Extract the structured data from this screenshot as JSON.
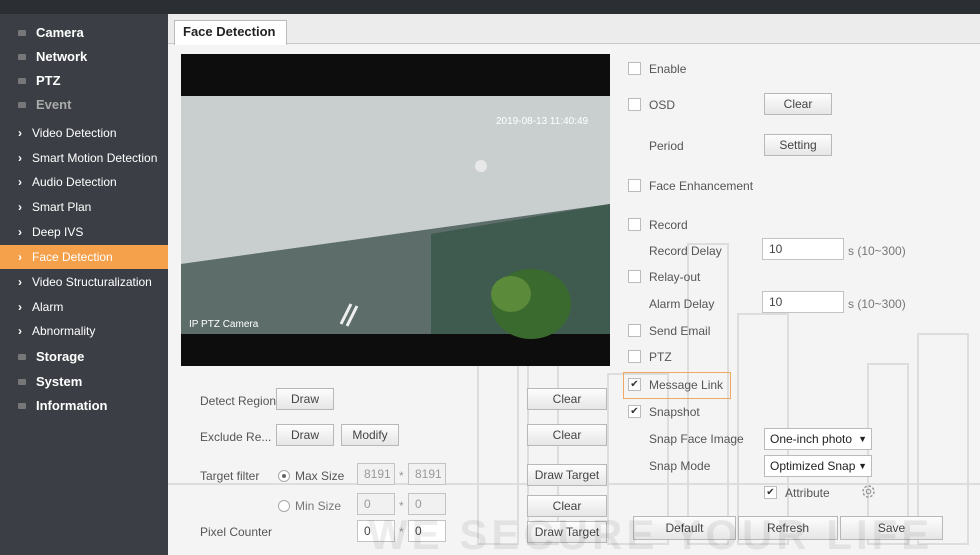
{
  "sidebar": {
    "items": [
      {
        "label": "Camera"
      },
      {
        "label": "Network"
      },
      {
        "label": "PTZ"
      },
      {
        "label": "Event"
      },
      {
        "label": "Storage"
      },
      {
        "label": "System"
      },
      {
        "label": "Information"
      }
    ],
    "sub_items": [
      {
        "label": "Video Detection"
      },
      {
        "label": "Smart Motion Detection"
      },
      {
        "label": "Audio Detection"
      },
      {
        "label": "Smart Plan"
      },
      {
        "label": "Deep IVS"
      },
      {
        "label": "Face Detection"
      },
      {
        "label": "Video Structuralization"
      },
      {
        "label": "Alarm"
      },
      {
        "label": "Abnormality"
      }
    ],
    "active": "Face Detection"
  },
  "tab": {
    "label": "Face Detection"
  },
  "video": {
    "timestamp": "2019-08-13 11:40:49",
    "channel_name": "IP PTZ Camera"
  },
  "left": {
    "detect_region_label": "Detect Region",
    "exclude_label": "Exclude Re...",
    "target_filter_label": "Target filter",
    "max_size_label": "Max Size",
    "min_size_label": "Min Size",
    "pixel_counter_label": "Pixel Counter",
    "draw": "Draw",
    "modify": "Modify",
    "clear": "Clear",
    "draw_target": "Draw Target",
    "max_w": "8191",
    "max_h": "8191",
    "min_w": "0",
    "min_h": "0",
    "pix_w": "0",
    "pix_h": "0",
    "sep": "*"
  },
  "right": {
    "enable": "Enable",
    "osd": "OSD",
    "clear": "Clear",
    "period": "Period",
    "setting": "Setting",
    "face_enhancement": "Face Enhancement",
    "record": "Record",
    "record_delay": "Record Delay",
    "record_delay_value": "10",
    "range": "s (10~300)",
    "relay_out": "Relay-out",
    "alarm_delay": "Alarm Delay",
    "alarm_delay_value": "10",
    "send_email": "Send Email",
    "ptz": "PTZ",
    "message_link": "Message Link",
    "snapshot": "Snapshot",
    "snap_face_image": "Snap Face Image",
    "snap_face_image_value": "One-inch photo",
    "snap_mode": "Snap Mode",
    "snap_mode_value": "Optimized Snap",
    "attribute": "Attribute",
    "check": "✔"
  },
  "footer": {
    "default": "Default",
    "refresh": "Refresh",
    "save": "Save"
  },
  "watermark": "WE SECURE YOUR LIFE",
  "colors": {
    "sidebar": "#3b3f45",
    "active": "#f5a04a",
    "highlight": "#f0a860"
  }
}
